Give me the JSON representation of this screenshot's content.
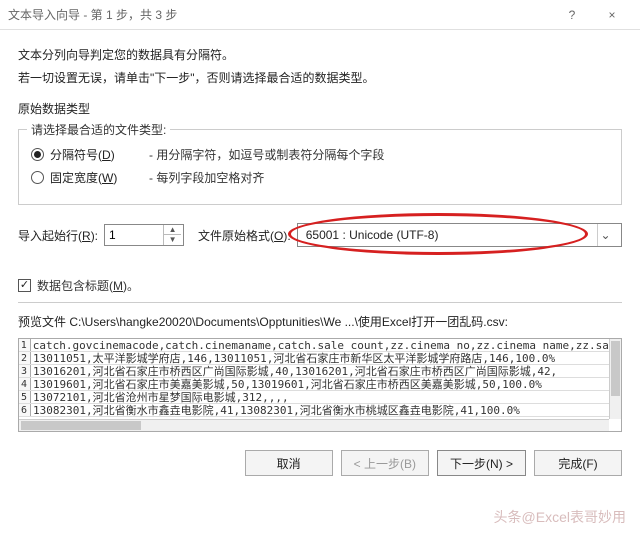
{
  "window": {
    "title": "文本导入向导 - 第 1 步，共 3 步",
    "help": "?",
    "close": "×"
  },
  "intro": {
    "line1": "文本分列向导判定您的数据具有分隔符。",
    "line2": "若一切设置无误，请单击\"下一步\"，否则请选择最合适的数据类型。"
  },
  "original": {
    "section": "原始数据类型",
    "legend": "请选择最合适的文件类型:",
    "opt_delimited_label": "分隔符号",
    "opt_delimited_key": "D",
    "opt_delimited_desc": "- 用分隔字符，如逗号或制表符分隔每个字段",
    "opt_fixed_label": "固定宽度",
    "opt_fixed_key": "W",
    "opt_fixed_desc": "- 每列字段加空格对齐"
  },
  "origin": {
    "start_label": "导入起始行",
    "start_key": "R",
    "start_value": "1",
    "encoding_label": "文件原始格式",
    "encoding_key": "O",
    "encoding_value": "65001 : Unicode (UTF-8)"
  },
  "headings": {
    "label": "数据包含标题",
    "key": "M",
    "checked": true
  },
  "preview": {
    "label": "预览文件 C:\\Users\\hangke20020\\Documents\\Opptunities\\We ...\\使用Excel打开一团乱码.csv:",
    "lines": [
      {
        "n": "1",
        "t": "catch.govcinemacode,catch.cinemaname,catch.sale_count,zz.cinema_no,zz.cinema_name,zz.sale_"
      },
      {
        "n": "2",
        "t": "13011051,太平洋影城学府店,146,13011051,河北省石家庄市新华区太平洋影城学府路店,146,100.0%"
      },
      {
        "n": "3",
        "t": "13016201,河北省石家庄市桥西区广尚国际影城,40,13016201,河北省石家庄市桥西区广尚国际影城,42,"
      },
      {
        "n": "4",
        "t": "13019601,河北省石家庄市美嘉美影城,50,13019601,河北省石家庄市桥西区美嘉美影城,50,100.0%"
      },
      {
        "n": "5",
        "t": "13072101,河北省沧州市星梦国际电影城,312,,,,"
      },
      {
        "n": "6",
        "t": "13082301,河北省衡水市鑫垚电影院,41,13082301,河北省衡水市桃城区鑫垚电影院,41,100.0%"
      }
    ]
  },
  "buttons": {
    "cancel": "取消",
    "back": "< 上一步(B)",
    "next": "下一步(N) >",
    "finish": "完成(F)"
  },
  "watermark": "头条@Excel表哥妙用"
}
